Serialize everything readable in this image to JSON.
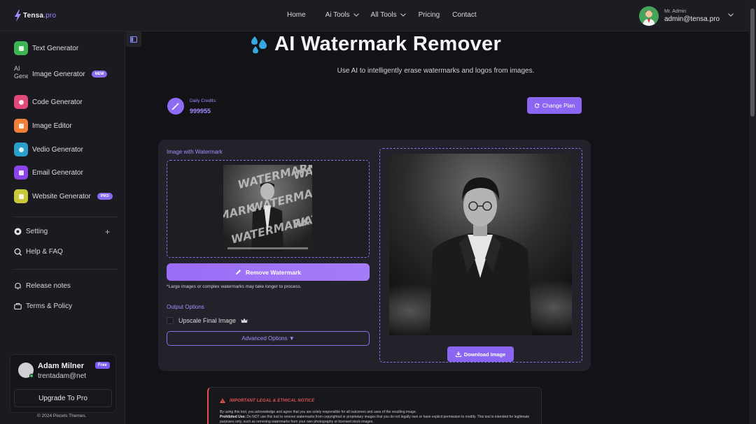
{
  "header": {
    "logo_main": "Tensa",
    "logo_suffix": ".pro",
    "nav": [
      {
        "label": "Home"
      },
      {
        "label": "Ai Tools"
      },
      {
        "label": "All Tools"
      },
      {
        "label": "Pricing"
      },
      {
        "label": "Contact"
      }
    ],
    "user": {
      "role": "Mr. Admin",
      "email": "admin@tensa.pro"
    }
  },
  "sidebar": {
    "items": [
      {
        "label": "Text Generator",
        "color": "#3cb454"
      },
      {
        "label": "Image Generator",
        "badge": "NEW",
        "alt_text": "AI Gene"
      },
      {
        "label": "Code Generator",
        "color": "#e0497a"
      },
      {
        "label": "Image Editor",
        "color": "#f07f3a"
      },
      {
        "label": "Vedio Generator",
        "color": "#2a9fc9"
      },
      {
        "label": "Email Generator",
        "color": "#8b44e8"
      },
      {
        "label": "Website Generator",
        "badge": "PRO",
        "color": "#c9c73a"
      }
    ],
    "setting": "Setting",
    "help": "Help & FAQ",
    "release": "Release notes",
    "terms": "Terms & Policy",
    "profile": {
      "name": "Adam Milner",
      "email": "trentadam@net",
      "plan": "Free",
      "upgrade": "Upgrade To Pro"
    },
    "copyright": "© 2024 Pixcels Themes."
  },
  "main": {
    "title": "AI Watermark Remover",
    "subtitle": "Use AI to intelligently erase watermarks and logos from images.",
    "credits_label": "Daily Credits:",
    "credits_value": "999955",
    "change_plan": "Change Plan",
    "input_label": "Image with Watermark",
    "watermark_text": "WATERMARK",
    "remove_button": "Remove Watermark",
    "note": "*Large images or complex watermarks may take longer to process.",
    "output_label": "Output Options",
    "upscale_label": "Upscale Final Image",
    "upscale_checked": false,
    "advanced": "Advanced Options ▼",
    "download": "Download Image",
    "notice_title": "IMPORTANT LEGAL & ETHICAL NOTICE",
    "notice_line1": "By using this tool, you acknowledge and agree that you are solely responsible for all outcomes and uses of the resulting image.",
    "notice_prohibited_label": "Prohibited Use:",
    "notice_line2": "Do NOT use this tool to remove watermarks from copyrighted or proprietary images that you do not legally own or have explicit permission to modify. This tool is intended for legitimate purposes only, such as removing watermarks from your own photography or licensed stock images."
  },
  "colors": {
    "accent": "#8a66f2",
    "accent_text": "#a88cff",
    "warning": "#e05050"
  }
}
